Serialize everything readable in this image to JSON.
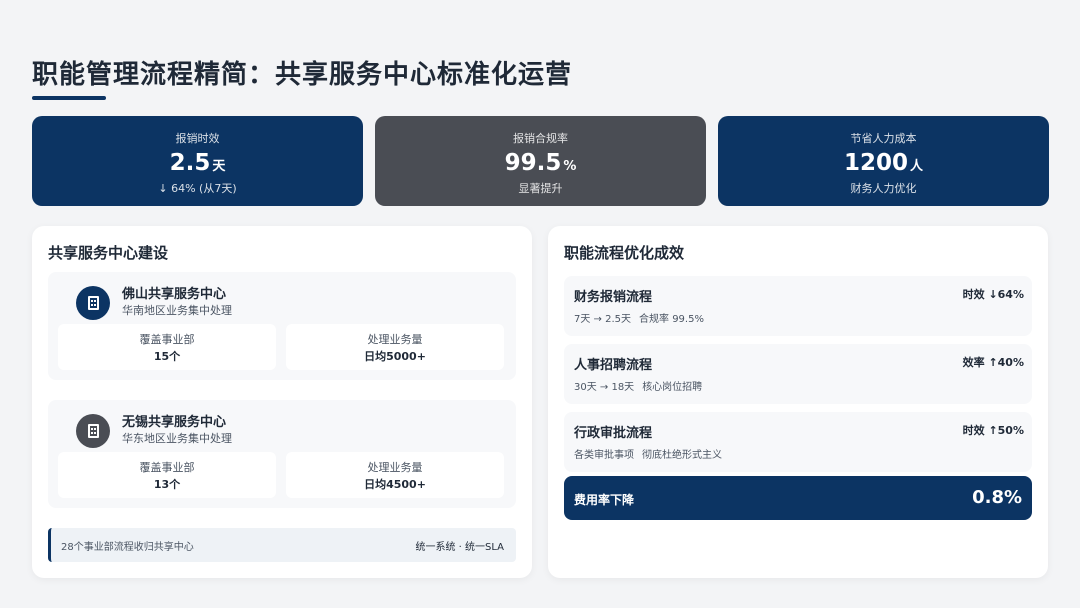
{
  "header": {
    "title": "职能管理流程精简：共享服务中心标准化运营"
  },
  "kpis": [
    {
      "label": "报销时效",
      "value": "2.5",
      "unit": "天",
      "sub": "↓ 64% (从7天)"
    },
    {
      "label": "报销合规率",
      "value": "99.5",
      "unit": "%",
      "sub": "显著提升"
    },
    {
      "label": "节省人力成本",
      "value": "1200",
      "unit": "人",
      "sub": "财务人力优化"
    }
  ],
  "left_panel": {
    "title": "共享服务中心建设",
    "centers": [
      {
        "name": "佛山共享服务中心",
        "desc": "华南地区业务集中处理",
        "stats": [
          {
            "label": "覆盖事业部",
            "value": "15个"
          },
          {
            "label": "处理业务量",
            "value": "日均5000+"
          }
        ]
      },
      {
        "name": "无锡共享服务中心",
        "desc": "华东地区业务集中处理",
        "stats": [
          {
            "label": "覆盖事业部",
            "value": "13个"
          },
          {
            "label": "处理业务量",
            "value": "日均4500+"
          }
        ]
      }
    ],
    "note": {
      "left": "28个事业部流程收归共享中心",
      "right": "统一系统 · 统一SLA"
    }
  },
  "right_panel": {
    "title": "职能流程优化成效",
    "flows": [
      {
        "name": "财务报销流程",
        "metric": "时效 ↓64%",
        "sub": "7天 → 2.5天",
        "tag": "合规率 99.5%"
      },
      {
        "name": "人事招聘流程",
        "metric": "效率 ↑40%",
        "sub": "30天 → 18天",
        "tag": "核心岗位招聘"
      },
      {
        "name": "行政审批流程",
        "metric": "时效 ↑50%",
        "sub": "各类审批事项",
        "tag": "彻底杜绝形式主义"
      }
    ],
    "cost": {
      "label": "费用率下降",
      "value": "0.8%"
    }
  },
  "colors": {
    "navy": "#0c3463",
    "gray": "#4a4d54",
    "background": "#f3f4f6"
  }
}
